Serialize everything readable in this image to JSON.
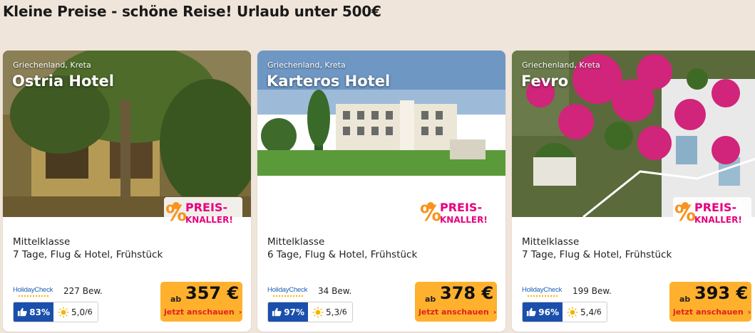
{
  "heading": "Kleine Preise - schöne Reise! Urlaub unter 500€",
  "badge": {
    "line1": "PREIS-",
    "line2": "KNALLER!"
  },
  "colors": {
    "background": "#efe5da",
    "price_bg": "#ffb12d",
    "cta": "#e02020",
    "rating_blue": "#1a4fad",
    "badge_pink": "#e6007e",
    "badge_orange": "#f7931e"
  },
  "cards": [
    {
      "location": "Griechenland, Kreta",
      "name": "Ostria Hotel",
      "class": "Mittelklasse",
      "description": "7 Tage, Flug & Hotel, Frühstück",
      "provider": "HolidayCheck",
      "reviews": "227 Bew.",
      "recommendation": "83%",
      "sun_score": "5,0",
      "sun_max": "/6",
      "price_prefix": "ab",
      "price": "357 €",
      "cta": "jetzt anschauen",
      "icons": [
        "thumbs-up-icon",
        "sun-icon",
        "chevron-right-icon"
      ]
    },
    {
      "location": "Griechenland, Kreta",
      "name": "Karteros Hotel",
      "class": "Mittelklasse",
      "description": "6 Tage, Flug & Hotel, Frühstück",
      "provider": "HolidayCheck",
      "reviews": "34 Bew.",
      "recommendation": "97%",
      "sun_score": "5,3",
      "sun_max": "/6",
      "price_prefix": "ab",
      "price": "378 €",
      "cta": "jetzt anschauen",
      "icons": [
        "thumbs-up-icon",
        "sun-icon",
        "chevron-right-icon"
      ]
    },
    {
      "location": "Griechenland, Kreta",
      "name": "Fevro",
      "class": "Mittelklasse",
      "description": "7 Tage, Flug & Hotel, Frühstück",
      "provider": "HolidayCheck",
      "reviews": "199 Bew.",
      "recommendation": "96%",
      "sun_score": "5,4",
      "sun_max": "/6",
      "price_prefix": "ab",
      "price": "393 €",
      "cta": "jetzt anschauen",
      "icons": [
        "thumbs-up-icon",
        "sun-icon",
        "chevron-right-icon"
      ]
    }
  ]
}
